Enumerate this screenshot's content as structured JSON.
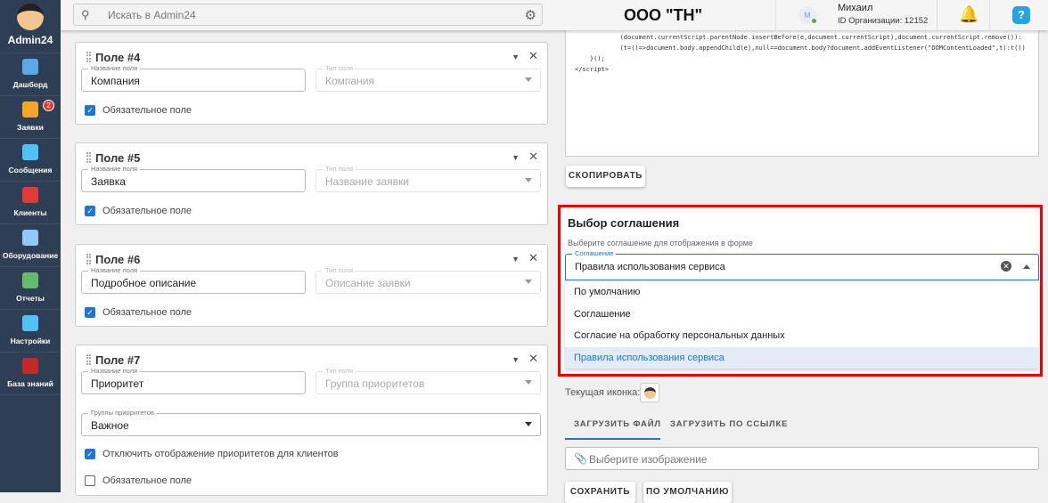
{
  "sidebar": {
    "brand": "Admin24",
    "items": [
      {
        "label": "Дашборд",
        "icon": "dashboard-icon",
        "color": "#5aa9e6"
      },
      {
        "label": "Заявки",
        "icon": "megaphone-icon",
        "color": "#f5a623",
        "badge": "2"
      },
      {
        "label": "Сообщения",
        "icon": "chat-icon",
        "color": "#4fc3f7"
      },
      {
        "label": "Клиенты",
        "icon": "users-icon",
        "color": "#e53935"
      },
      {
        "label": "Оборудование",
        "icon": "equipment-icon",
        "color": "#90caf9"
      },
      {
        "label": "Отчеты",
        "icon": "report-icon",
        "color": "#66bb6a"
      },
      {
        "label": "Настройки",
        "icon": "gear-icon",
        "color": "#4fc3f7"
      },
      {
        "label": "База знаний",
        "icon": "book-icon",
        "color": "#c62828"
      }
    ]
  },
  "header": {
    "search_placeholder": "Искать в Admin24",
    "org": "ООО \"ТН\"",
    "avatar_letter": "М",
    "user_name": "Михаил",
    "org_id": "ID Организации: 12152",
    "help": "?"
  },
  "fields": [
    {
      "title": "Поле #4",
      "name_label": "Название поля",
      "name_value": "Компания",
      "type_label": "Тип поля",
      "type_value": "Компания",
      "required_label": "Обязательное поле",
      "required": true
    },
    {
      "title": "Поле #5",
      "name_label": "Название поля",
      "name_value": "Заявка",
      "type_label": "Тип поля",
      "type_value": "Название заявки",
      "required_label": "Обязательное поле",
      "required": true
    },
    {
      "title": "Поле #6",
      "name_label": "Название поля",
      "name_value": "Подробное описание",
      "type_label": "Тип поля",
      "type_value": "Описание заявки",
      "required_label": "Обязательное поле",
      "required": true
    },
    {
      "title": "Поле #7",
      "name_label": "Название поля",
      "name_value": "Приоритет",
      "type_label": "Тип поля",
      "type_value": "Группа приоритетов",
      "groups_label": "Группы приоритетов",
      "groups_value": "Важное",
      "hide_label": "Отключить отображение приоритетов для клиентов",
      "hide": true,
      "required_label": "Обязательное поле",
      "required": false
    }
  ],
  "code": "            (document.currentScript.parentNode.insertBefore(e,document.currentScript),document.currentScript.remove()):\n            (t=()=>document.body.appendChild(e),null==document.body?document.addEventListener(\"DOMContentLoaded\",t):t())\n    }();\n</script>",
  "copy_label": "СКОПИРОВАТЬ",
  "agreement": {
    "title": "Выбор соглашения",
    "subtitle": "Выберите соглашение для отображения в форме",
    "select_label": "Соглашение",
    "selected": "Правила использования сервиса",
    "options": [
      "По умолчанию",
      "Соглашение",
      "Согласие на обработку персональных данных",
      "Правила использования сервиса"
    ]
  },
  "icon_section": {
    "current_label": "Текущая иконка:",
    "tabs": [
      "ЗАГРУЗИТЬ ФАЙЛ",
      "ЗАГРУЗИТЬ ПО ССЫЛКЕ"
    ],
    "file_placeholder": "Выберите изображение",
    "save_label": "СОХРАНИТЬ",
    "default_label": "ПО УМОЛЧАНИЮ"
  }
}
